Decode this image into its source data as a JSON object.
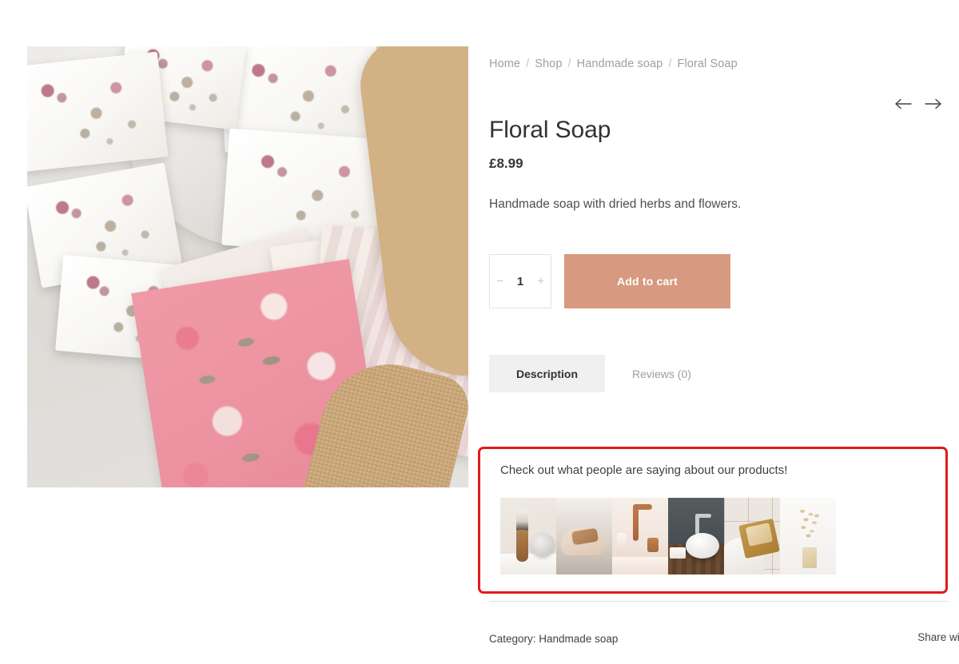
{
  "breadcrumb": {
    "items": [
      {
        "label": "Home"
      },
      {
        "label": "Shop"
      },
      {
        "label": "Handmade soap"
      },
      {
        "label": "Floral Soap"
      }
    ],
    "separator": "/"
  },
  "nav": {
    "prev_icon": "arrow-left-icon",
    "next_icon": "arrow-right-icon"
  },
  "product": {
    "title": "Floral Soap",
    "price": "£8.99",
    "description": "Handmade soap with dried herbs and flowers.",
    "image_alt": "Handmade white soap bars with dried rose petals on a wooden board beside pink floral patterned papers and burlap ribbon"
  },
  "purchase": {
    "quantity_decrement": "−",
    "quantity_value": "1",
    "quantity_increment": "+",
    "add_to_cart_label": "Add to cart",
    "add_to_cart_color": "#d79980"
  },
  "tabs": [
    {
      "label": "Description",
      "active": true
    },
    {
      "label": "Reviews (0)",
      "active": false
    }
  ],
  "highlight_panel": {
    "border_color": "#e01b1b",
    "heading": "Check out what people are saying about our products!",
    "thumbnails": [
      {
        "alt": "shaving brush and soap puck on a white towel"
      },
      {
        "alt": "hands lathering a bar of soap"
      },
      {
        "alt": "copper faucet over a pink bathroom sink"
      },
      {
        "alt": "white vessel basin against a dark wall on a wooden floor"
      },
      {
        "alt": "soap bar resting on a wooden tray by a bathtub"
      },
      {
        "alt": "scattered oats beside a soap bar on white"
      }
    ]
  },
  "footer_meta": {
    "category_label": "Category:",
    "category_value": "Handmade soap",
    "category_line": "Category: Handmade soap",
    "share_label": "Share with"
  }
}
